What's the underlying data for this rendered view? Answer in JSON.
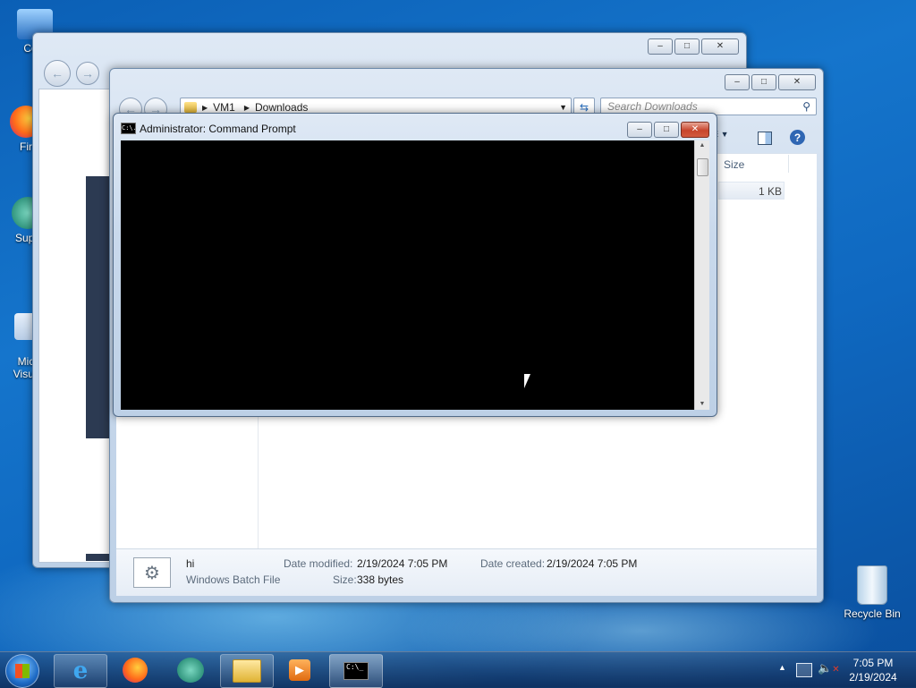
{
  "desktop": {
    "icons": [
      {
        "label": "Com"
      },
      {
        "label": "Fir"
      },
      {
        "label": "Supe"
      },
      {
        "label": "Micr\nVisual"
      },
      {
        "label": "Recycle Bin"
      }
    ]
  },
  "explorer": {
    "breadcrumb": [
      "VM1",
      "Downloads"
    ],
    "search_placeholder": "Search Downloads",
    "column_size": "Size",
    "file_size_cell": "1 KB",
    "details": {
      "name": "hi",
      "type": "Windows Batch File",
      "date_modified_label": "Date modified:",
      "date_modified_value": "2/19/2024 7:05 PM",
      "date_created_label": "Date created:",
      "date_created_value": "2/19/2024 7:05 PM",
      "size_label": "Size:",
      "size_value": "338 bytes"
    }
  },
  "cmd": {
    "title": "Administrator:  Command Prompt",
    "icon_text": "C:\\."
  },
  "taskbar": {
    "clock_time": "7:05 PM",
    "clock_date": "2/19/2024",
    "cmd_icon_text": "C:\\_"
  },
  "colors": {
    "accent": "#1575cc",
    "close_red": "#c7452c",
    "console_bg": "#000000"
  }
}
